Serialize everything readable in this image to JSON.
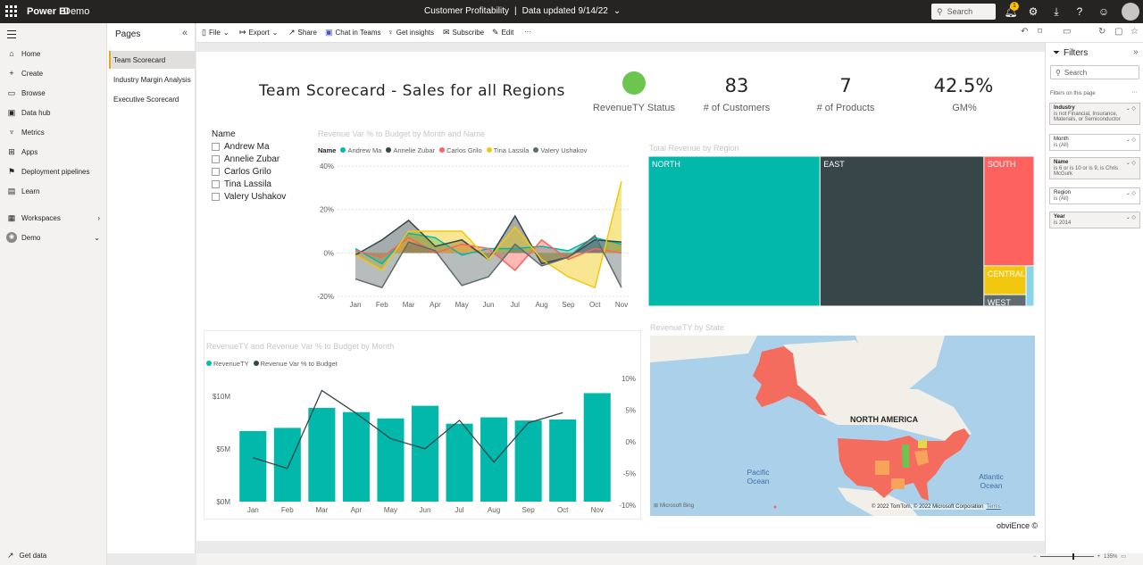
{
  "app": {
    "brand": "Power BI",
    "workspace": "Demo",
    "report_name": "Customer Profitability",
    "data_updated": "Data updated 9/14/22",
    "search_placeholder": "Search",
    "notification_count": "1"
  },
  "leftnav": {
    "items": [
      {
        "label": "Home",
        "icon": "home-icon"
      },
      {
        "label": "Create",
        "icon": "plus-icon"
      },
      {
        "label": "Browse",
        "icon": "folder-icon"
      },
      {
        "label": "Data hub",
        "icon": "data-hub-icon"
      },
      {
        "label": "Metrics",
        "icon": "trophy-icon"
      },
      {
        "label": "Apps",
        "icon": "apps-icon"
      },
      {
        "label": "Deployment pipelines",
        "icon": "rocket-icon"
      },
      {
        "label": "Learn",
        "icon": "book-icon"
      },
      {
        "label": "Workspaces",
        "icon": "workspaces-icon"
      },
      {
        "label": "Demo",
        "icon": "demo-workspace-icon"
      }
    ],
    "get_data": "Get data"
  },
  "pages": {
    "title": "Pages",
    "items": [
      "Team Scorecard",
      "Industry Margin Analysis",
      "Executive Scorecard"
    ],
    "active_index": 0
  },
  "toolbar": {
    "file": "File",
    "export": "Export",
    "share": "Share",
    "chat": "Chat in Teams",
    "insights": "Get insights",
    "subscribe": "Subscribe",
    "edit": "Edit",
    "more": "···"
  },
  "report": {
    "title": "Team Scorecard - Sales for all Regions",
    "kpis": [
      {
        "value": "",
        "label": "RevenueTY Status",
        "status_color": "#6cc54f"
      },
      {
        "value": "83",
        "label": "# of Customers"
      },
      {
        "value": "7",
        "label": "# of Products"
      },
      {
        "value": "42.5%",
        "label": "GM%"
      }
    ],
    "slicer": {
      "title": "Name",
      "items": [
        "Andrew Ma",
        "Annelie Zubar",
        "Carlos Grilo",
        "Tina Lassila",
        "Valery Ushakov"
      ]
    },
    "copyright": "obviEnce ©",
    "map": {
      "title": "RevenueTY by State",
      "labels": {
        "continent": "NORTH AMERICA",
        "pacific": "Pacific Ocean",
        "atlantic": "Atlantic Ocean"
      },
      "bing": "Microsoft Bing",
      "attribution": "© 2022 TomTom, © 2022 Microsoft Corporation",
      "terms": "Terms"
    }
  },
  "chart_data": [
    {
      "type": "line",
      "title": "Revenue Var % to Budget by Month and Name",
      "legend_title": "Name",
      "categories": [
        "Jan",
        "Feb",
        "Mar",
        "Apr",
        "May",
        "Jun",
        "Jul",
        "Aug",
        "Sep",
        "Oct",
        "Nov"
      ],
      "ylim": [
        -20,
        40
      ],
      "yticks": [
        "40%",
        "20%",
        "0%",
        "-20%"
      ],
      "series": [
        {
          "name": "Andrew Ma",
          "color": "#01b8aa",
          "values": [
            2,
            -5,
            9,
            7,
            -1,
            2,
            2,
            3,
            1,
            7,
            4
          ]
        },
        {
          "name": "Annelie Zubar",
          "color": "#374649",
          "values": [
            -1,
            6,
            15,
            3,
            6,
            -3,
            17,
            -5,
            -2,
            6,
            5
          ]
        },
        {
          "name": "Carlos Grilo",
          "color": "#fd625e",
          "values": [
            1,
            -2,
            7,
            0,
            4,
            2,
            -8,
            6,
            -3,
            2,
            0
          ]
        },
        {
          "name": "Tina Lassila",
          "color": "#f2c80f",
          "values": [
            -1,
            -8,
            10,
            10,
            10,
            -3,
            12,
            -3,
            -11,
            -16,
            33
          ]
        },
        {
          "name": "Valery Ushakov",
          "color": "#5f6b6d",
          "values": [
            -12,
            -16,
            5,
            1,
            -15,
            -11,
            4,
            -6,
            -2,
            8,
            -16
          ]
        }
      ]
    },
    {
      "type": "treemap",
      "title": "Total Revenue by Region",
      "categories": [
        "NORTH",
        "EAST",
        "SOUTH",
        "CENTRAL",
        "WEST"
      ],
      "values": [
        44.5,
        42.5,
        9.5,
        2.5,
        1.0
      ],
      "colors": [
        "#01b8aa",
        "#374649",
        "#fd625e",
        "#f2c80f",
        "#5f6b6d"
      ]
    },
    {
      "type": "bar",
      "title": "RevenueTY and Revenue Var % to Budget by Month",
      "categories": [
        "Jan",
        "Feb",
        "Mar",
        "Apr",
        "May",
        "Jun",
        "Jul",
        "Aug",
        "Sep",
        "Oct",
        "Nov"
      ],
      "series": [
        {
          "name": "RevenueTY",
          "color": "#01b8aa",
          "values": [
            6.7,
            7.0,
            8.9,
            8.5,
            7.9,
            9.1,
            7.4,
            8.0,
            7.7,
            7.8,
            10.3
          ],
          "unit": "M"
        },
        {
          "name": "Revenue Var % to Budget",
          "color": "#374649",
          "type": "line",
          "values": [
            -2.5,
            -4.2,
            8.1,
            4.5,
            0.5,
            -1.1,
            3.4,
            -3.2,
            3.0,
            4.6
          ]
        }
      ],
      "ylim_left": [
        0,
        10
      ],
      "yticks_left": [
        "$10M",
        "$5M",
        "$0M"
      ],
      "ylim_right": [
        -10,
        10
      ],
      "yticks_right": [
        "10%",
        "5%",
        "0%",
        "-5%",
        "-10%"
      ]
    }
  ],
  "filters": {
    "title": "Filters",
    "search_placeholder": "Search",
    "subtitle": "Filters on this page",
    "cards": [
      {
        "name": "Industry",
        "value": "is not Financial, Insurance, Materials, or Semiconductor",
        "active": true
      },
      {
        "name": "Month",
        "value": "is (All)",
        "active": false
      },
      {
        "name": "Name",
        "value": "is 6 or is 10 or is 9, is Chris McGurk",
        "active": true
      },
      {
        "name": "Region",
        "value": "is (All)",
        "active": false
      },
      {
        "name": "Year",
        "value": "is 2014",
        "active": true
      }
    ]
  },
  "statusbar": {
    "zoom": "135%"
  }
}
